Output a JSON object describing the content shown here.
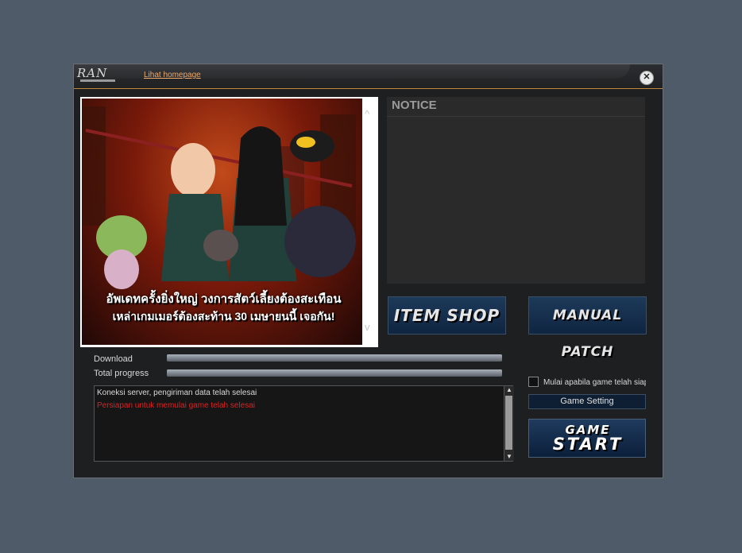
{
  "titlebar": {
    "logo_text": "RAN",
    "homepage_link": "Lihat homepage",
    "close_symbol": "✕"
  },
  "banner": {
    "caption_line1": "อัพเดทครั้งยิ่งใหญ่ วงการสัตว์เลี้ยงต้องสะเทือน",
    "caption_line2": "เหล่าเกมเมอร์ต้องสะท้าน 30 เมษายนนี้ เจอกัน!",
    "scroll_up": "^",
    "scroll_down": "v"
  },
  "notice": {
    "title": "NOTICE"
  },
  "buttons": {
    "item_shop": "ITEM SHOP",
    "manual_patch": "MANUAL PATCH",
    "game_setting": "Game Setting",
    "game_start_line1": "GAME",
    "game_start_line2": "START"
  },
  "progress": {
    "download_label": "Download",
    "download_value": 1.0,
    "total_label": "Total progress",
    "total_value": 1.0
  },
  "log": {
    "lines": [
      {
        "text": "Koneksi server, pengiriman data telah selesai",
        "color": "#d8d8d8"
      },
      {
        "text": "Persiapan untuk memulai game telah selesai",
        "color": "#e02020"
      }
    ]
  },
  "options": {
    "autostart_label": "Mulai apabila game telah siap",
    "autostart_checked": false
  },
  "colors": {
    "accent_link": "#f0a868",
    "error_text": "#e02020",
    "button_blue": "#1d3a5a"
  }
}
